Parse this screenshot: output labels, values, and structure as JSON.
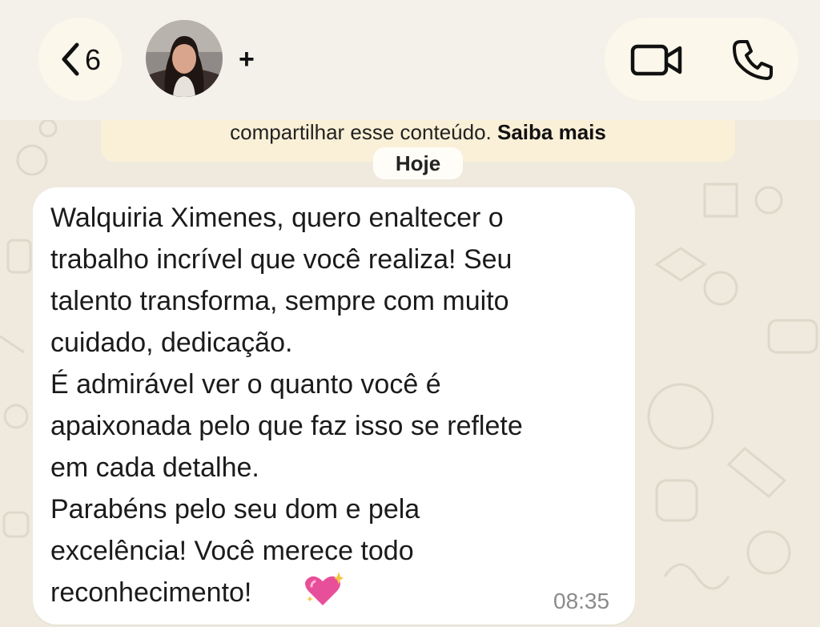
{
  "header": {
    "unread_count": "6",
    "add_label": "+",
    "icons": {
      "back": "chevron-left-icon",
      "video": "video-camera-icon",
      "phone": "phone-icon"
    }
  },
  "notice": {
    "text": "compartilhar esse conteúdo.",
    "link": "Saiba mais",
    "background": "#faf0d8"
  },
  "date_chip": "Hoje",
  "message": {
    "lines": [
      "Walquiria Ximenes, quero enaltecer o",
      "trabalho incrível que você realiza! Seu",
      "talento transforma, sempre com muito",
      "cuidado, dedicação.",
      "É admirável ver o quanto você é",
      "apaixonada pelo que faz isso se reflete",
      "em cada detalhe.",
      "Parabéns pelo seu dom e pela",
      "excelência! Você merece todo",
      "reconhecimento!"
    ],
    "emoji": "sparkling-heart-icon",
    "time": "08:35"
  },
  "colors": {
    "chat_background": "#efe9de",
    "bubble": "#ffffff",
    "pill": "#fbf7ea",
    "heart": "#e84f9a"
  }
}
